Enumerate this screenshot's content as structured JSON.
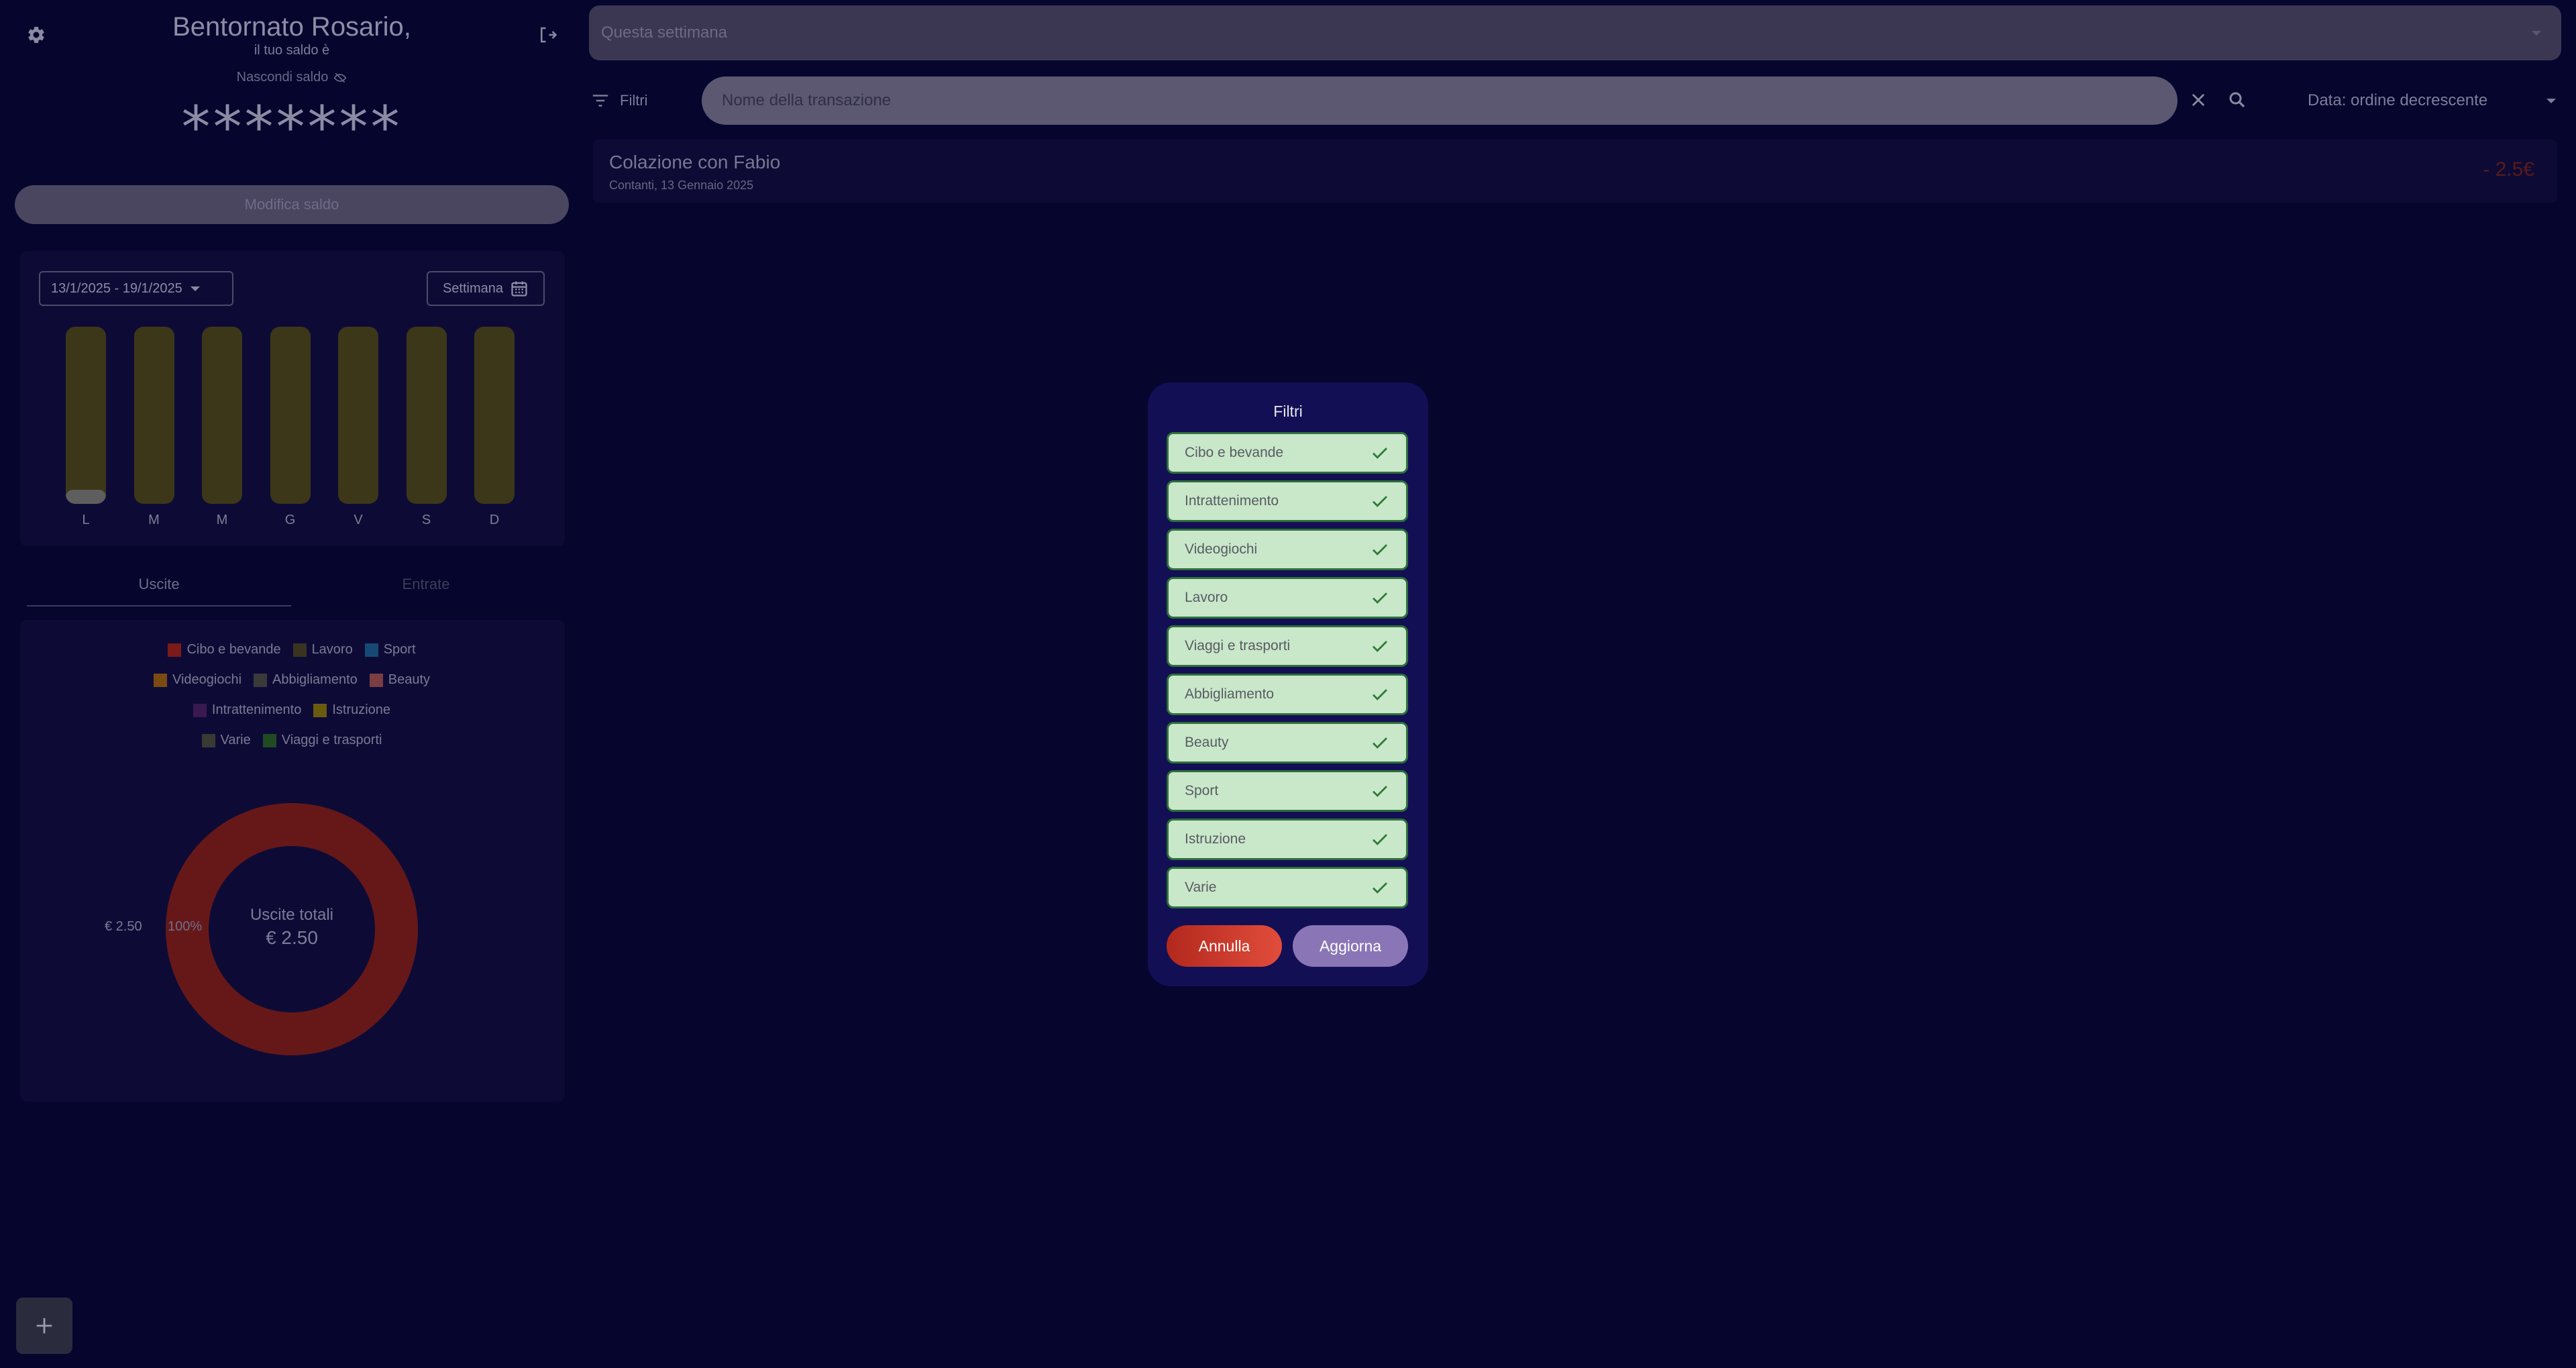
{
  "colors": {
    "background": "#05052e",
    "card": "#0d0b36",
    "modal": "#130f55",
    "filter_option": "#c8e8c9",
    "checkmark": "#2f7a3a",
    "cancel": "#d23a2c",
    "update": "#8a76b6"
  },
  "header": {
    "settings_icon": "gear-icon",
    "logout_icon": "logout-icon",
    "greeting": "Bentornato Rosario,",
    "subtitle": "il tuo saldo è",
    "hide_balance_label": "Nascondi saldo",
    "hide_balance_icon": "eye-off-icon",
    "balance_masked": "*******",
    "edit_balance_label": "Modifica saldo"
  },
  "weekly_chart": {
    "range_label": "13/1/2025 - 19/1/2025",
    "period_label": "Settimana",
    "days": [
      "L",
      "M",
      "M",
      "G",
      "V",
      "S",
      "D"
    ],
    "fill": [
      0.08,
      0,
      0,
      0,
      0,
      0,
      0
    ]
  },
  "tabs": [
    {
      "label": "Uscite",
      "active": true
    },
    {
      "label": "Entrate",
      "active": false
    }
  ],
  "legend_rows": [
    [
      {
        "label": "Cibo e bevande",
        "color": "#7c1a1a"
      },
      {
        "label": "Lavoro",
        "color": "#3a3320"
      },
      {
        "label": "Sport",
        "color": "#164a74"
      }
    ],
    [
      {
        "label": "Videogiochi",
        "color": "#7a4a12"
      },
      {
        "label": "Abbigliamento",
        "color": "#3a3a3a"
      },
      {
        "label": "Beauty",
        "color": "#7a3e44"
      }
    ],
    [
      {
        "label": "Intrattenimento",
        "color": "#3a1950"
      },
      {
        "label": "Istruzione",
        "color": "#6a5a10"
      }
    ],
    [
      {
        "label": "Varie",
        "color": "#3a3a34"
      },
      {
        "label": "Viaggi e trasporti",
        "color": "#1f4a22"
      }
    ]
  ],
  "chart_data": {
    "type": "pie",
    "categories": [
      "Cibo e bevande"
    ],
    "values": [
      2.5
    ],
    "center_title": "Uscite totali",
    "center_value": "€ 2.50",
    "slice_value_label": "€ 2.50",
    "slice_percent_label": "100%"
  },
  "add_button_icon": "plus-icon",
  "period_select": {
    "value": "Questa settimana"
  },
  "toolbar": {
    "filters_label": "Filtri",
    "filters_icon": "filter-icon",
    "search_placeholder": "Nome della transazione",
    "clear_icon": "close-icon",
    "search_icon": "search-icon",
    "sort_label": "Data: ordine decrescente"
  },
  "transactions": [
    {
      "name": "Colazione con Fabio",
      "meta": "Contanti,  13 Gennaio 2025",
      "amount": "- 2.5€"
    }
  ],
  "filter_modal": {
    "title": "Filtri",
    "options": [
      {
        "label": "Cibo e bevande",
        "checked": true
      },
      {
        "label": "Intrattenimento",
        "checked": true
      },
      {
        "label": "Videogiochi",
        "checked": true
      },
      {
        "label": "Lavoro",
        "checked": true
      },
      {
        "label": "Viaggi e trasporti",
        "checked": true
      },
      {
        "label": "Abbigliamento",
        "checked": true
      },
      {
        "label": "Beauty",
        "checked": true
      },
      {
        "label": "Sport",
        "checked": true
      },
      {
        "label": "Istruzione",
        "checked": true
      },
      {
        "label": "Varie",
        "checked": true
      }
    ],
    "cancel_label": "Annulla",
    "update_label": "Aggiorna"
  }
}
